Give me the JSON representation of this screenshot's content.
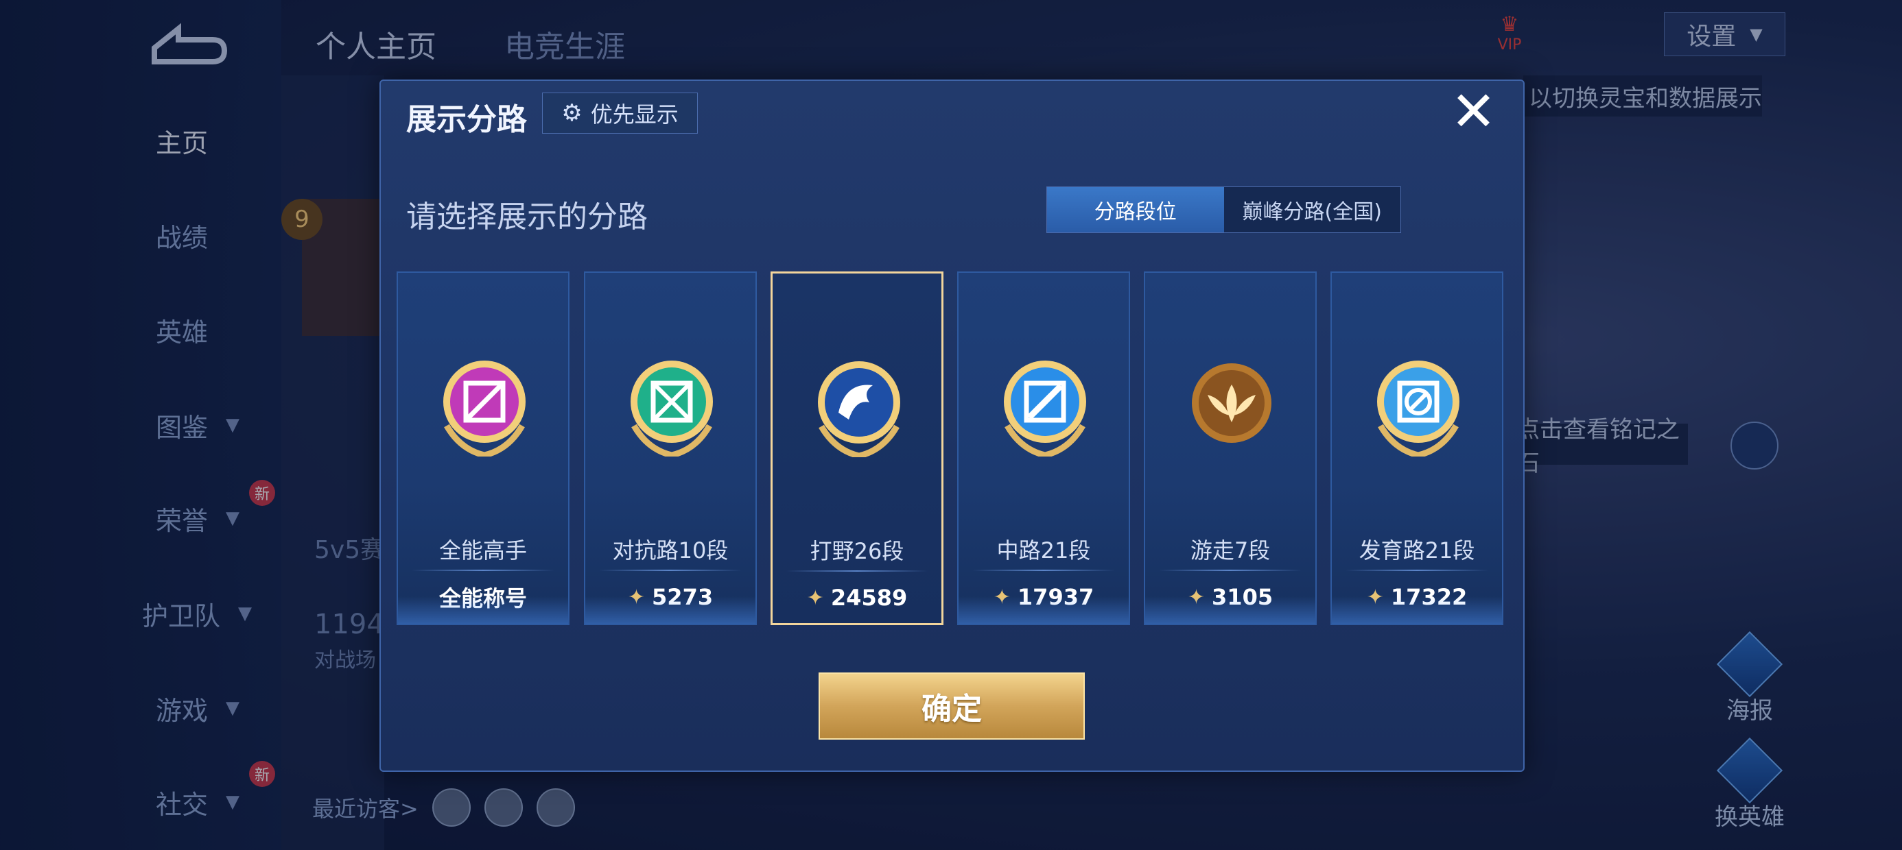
{
  "top_tabs": [
    "个人主页",
    "电竞生涯"
  ],
  "nav": {
    "items": [
      {
        "label": "主页",
        "has_chevron": false,
        "new": false
      },
      {
        "label": "战绩",
        "has_chevron": false,
        "new": false
      },
      {
        "label": "英雄",
        "has_chevron": false,
        "new": false
      },
      {
        "label": "图鉴",
        "has_chevron": true,
        "new": false
      },
      {
        "label": "荣誉",
        "has_chevron": true,
        "new": true
      },
      {
        "label": "护卫队",
        "has_chevron": true,
        "new": false
      },
      {
        "label": "游戏",
        "has_chevron": true,
        "new": false
      },
      {
        "label": "社交",
        "has_chevron": true,
        "new": true
      }
    ],
    "new_badge": "新"
  },
  "profile": {
    "rank_level": "9",
    "mode_text": "5v5赛",
    "number_text": "1194",
    "sub_text": "对战场",
    "visitors_label": "最近访客>"
  },
  "header": {
    "vip_label": "VIP",
    "settings_label": "设置"
  },
  "hints": {
    "switch_text": "以切换灵宝和数据展示",
    "inscription_text": "点击查看铭记之石"
  },
  "right_buttons": [
    {
      "label": "海报",
      "icon": "poster-icon"
    },
    {
      "label": "换英雄",
      "icon": "swap-hero-icon"
    }
  ],
  "modal": {
    "title": "展示分路",
    "priority_label": "优先显示",
    "subtitle": "请选择展示的分路",
    "toggle": [
      "分路段位",
      "巅峰分路(全国)"
    ],
    "toggle_active": 0,
    "confirm_label": "确定",
    "cards": [
      {
        "name": "全能高手",
        "stat": "全能称号",
        "show_wing": false,
        "color": "#c03ab8"
      },
      {
        "name": "对抗路10段",
        "stat": "5273",
        "show_wing": true,
        "color": "#1fb08a"
      },
      {
        "name": "打野26段",
        "stat": "24589",
        "show_wing": true,
        "color": "#2a6fd0",
        "selected": true
      },
      {
        "name": "中路21段",
        "stat": "17937",
        "show_wing": true,
        "color": "#2a8ee8"
      },
      {
        "name": "游走7段",
        "stat": "3105",
        "show_wing": true,
        "color": "#c58a3a"
      },
      {
        "name": "发育路21段",
        "stat": "17322",
        "show_wing": true,
        "color": "#3aa0e8"
      }
    ]
  }
}
